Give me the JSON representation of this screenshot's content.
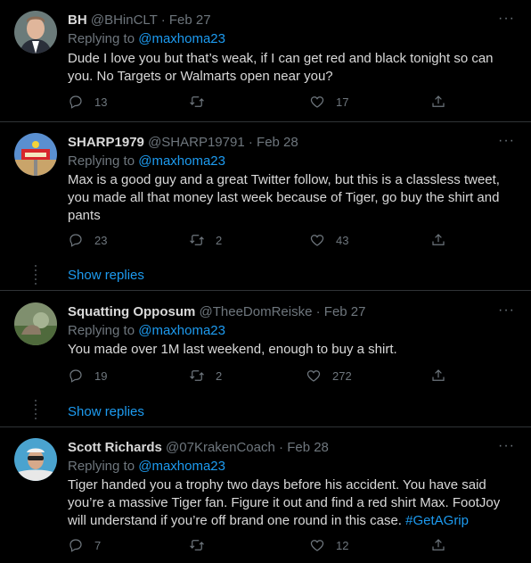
{
  "tweets": [
    {
      "name": "BH",
      "handle": "@BHinCLT",
      "date": "Feb 27",
      "replying_prefix": "Replying to",
      "replying_to": "@maxhoma23",
      "text": "Dude I love you but that’s weak, if I can get red and black tonight so can you.  No Targets or Walmarts open near you?",
      "replies": "13",
      "retweets": "",
      "likes": "17"
    },
    {
      "name": "SHARP1979",
      "handle": "@SHARP19791",
      "date": "Feb 28",
      "replying_prefix": "Replying to",
      "replying_to": "@maxhoma23",
      "text": "Max is a good guy and a great Twitter follow, but this is a classless tweet, you made all that money last week because of Tiger, go buy the shirt and pants",
      "replies": "23",
      "retweets": "2",
      "likes": "43",
      "show_replies": "Show replies"
    },
    {
      "name": "Squatting Opposum",
      "handle": "@TheeDomReiske",
      "date": "Feb 27",
      "replying_prefix": "Replying to",
      "replying_to": "@maxhoma23",
      "text": "You made over 1M last weekend, enough to buy a shirt.",
      "replies": "19",
      "retweets": "2",
      "likes": "272",
      "show_replies": "Show replies"
    },
    {
      "name": "Scott Richards",
      "handle": "@07KrakenCoach",
      "date": "Feb 28",
      "replying_prefix": "Replying to",
      "replying_to": "@maxhoma23",
      "text": "Tiger handed you a trophy two days before his accident.  You have said you’re a massive Tiger fan.  Figure it out and find a red shirt Max.  FootJoy will understand if you’re off brand one round in this case.",
      "hashtag": "#GetAGrip",
      "replies": "7",
      "retweets": "",
      "likes": "12"
    }
  ],
  "separator": "·",
  "more_glyph": "···",
  "colors": {
    "background": "#000000",
    "text": "#d9d9d9",
    "secondary": "#6e767d",
    "link": "#1d9bf0",
    "divider": "#2f3336"
  },
  "icons": [
    "reply-icon",
    "retweet-icon",
    "like-icon",
    "share-icon",
    "more-icon"
  ]
}
